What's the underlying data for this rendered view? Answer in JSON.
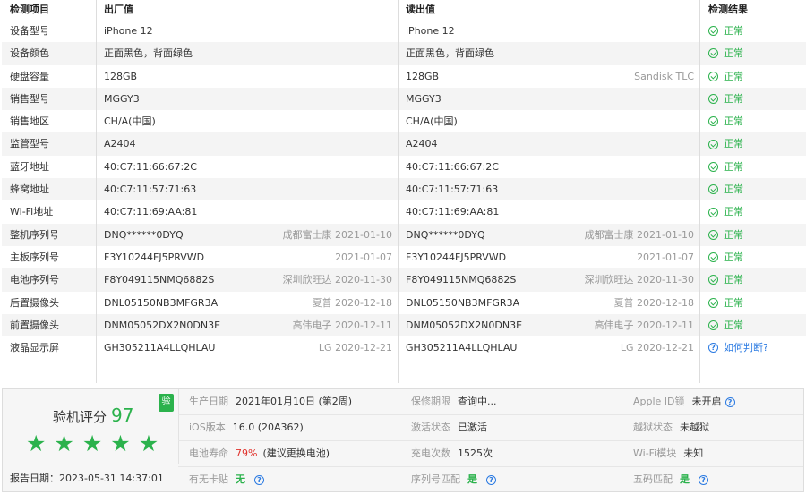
{
  "header": {
    "col1": "检测项目",
    "col2": "出厂值",
    "col3": "读出值",
    "col4": "检测结果"
  },
  "rows": [
    {
      "name": "设备型号",
      "factory": "iPhone 12",
      "factory_note": "",
      "read": "iPhone 12",
      "read_note": "",
      "result": "正常"
    },
    {
      "name": "设备颜色",
      "factory": "正面黑色，背面绿色",
      "factory_note": "",
      "read": "正面黑色，背面绿色",
      "read_note": "",
      "result": "正常"
    },
    {
      "name": "硬盘容量",
      "factory": "128GB",
      "factory_note": "",
      "read": "128GB",
      "read_note": "Sandisk TLC",
      "result": "正常"
    },
    {
      "name": "销售型号",
      "factory": "MGGY3",
      "factory_note": "",
      "read": "MGGY3",
      "read_note": "",
      "result": "正常"
    },
    {
      "name": "销售地区",
      "factory": "CH/A(中国)",
      "factory_note": "",
      "read": "CH/A(中国)",
      "read_note": "",
      "result": "正常"
    },
    {
      "name": "监管型号",
      "factory": "A2404",
      "factory_note": "",
      "read": "A2404",
      "read_note": "",
      "result": "正常"
    },
    {
      "name": "蓝牙地址",
      "factory": "40:C7:11:66:67:2C",
      "factory_note": "",
      "read": "40:C7:11:66:67:2C",
      "read_note": "",
      "result": "正常"
    },
    {
      "name": "蜂窝地址",
      "factory": "40:C7:11:57:71:63",
      "factory_note": "",
      "read": "40:C7:11:57:71:63",
      "read_note": "",
      "result": "正常"
    },
    {
      "name": "Wi-Fi地址",
      "factory": "40:C7:11:69:AA:81",
      "factory_note": "",
      "read": "40:C7:11:69:AA:81",
      "read_note": "",
      "result": "正常"
    },
    {
      "name": "整机序列号",
      "factory": "DNQ******0DYQ",
      "factory_note": "成都富士康 2021-01-10",
      "read": "DNQ******0DYQ",
      "read_note": "成都富士康 2021-01-10",
      "result": "正常"
    },
    {
      "name": "主板序列号",
      "factory": "F3Y10244FJ5PRVWD",
      "factory_note": "2021-01-07",
      "read": "F3Y10244FJ5PRVWD",
      "read_note": "2021-01-07",
      "result": "正常"
    },
    {
      "name": "电池序列号",
      "factory": "F8Y049115NMQ6882S",
      "factory_note": "深圳欣旺达 2020-11-30",
      "read": "F8Y049115NMQ6882S",
      "read_note": "深圳欣旺达 2020-11-30",
      "result": "正常"
    },
    {
      "name": "后置摄像头",
      "factory": "DNL05150NB3MFGR3A",
      "factory_note": "夏普 2020-12-18",
      "read": "DNL05150NB3MFGR3A",
      "read_note": "夏普 2020-12-18",
      "result": "正常"
    },
    {
      "name": "前置摄像头",
      "factory": "DNM05052DX2N0DN3E",
      "factory_note": "高伟电子 2020-12-11",
      "read": "DNM05052DX2N0DN3E",
      "read_note": "高伟电子 2020-12-11",
      "result": "正常"
    },
    {
      "name": "液晶显示屏",
      "factory": "GH305211A4LLQHLAU",
      "factory_note": "LG 2020-12-21",
      "read": "GH305211A4LLQHLAU",
      "read_note": "LG 2020-12-21",
      "result": "如何判断?",
      "result_type": "help"
    }
  ],
  "score": {
    "label": "验机评分",
    "value": "97",
    "badge": "验",
    "stars": 5,
    "date": "报告日期：2023-05-31 14:37:01"
  },
  "info": [
    [
      {
        "label": "生产日期",
        "value": "2021年01月10日 (第2周)"
      },
      {
        "label": "保修期限",
        "value": "查询中..."
      },
      {
        "label": "Apple ID锁",
        "value": "未开启",
        "help": true
      }
    ],
    [
      {
        "label": "iOS版本",
        "value": "16.0 (20A362)"
      },
      {
        "label": "激活状态",
        "value": "已激活"
      },
      {
        "label": "越狱状态",
        "value": "未越狱"
      }
    ],
    [
      {
        "label": "电池寿命",
        "value_red": "79%",
        "value": "(建议更换电池)"
      },
      {
        "label": "充电次数",
        "value": "1525次"
      },
      {
        "label": "Wi-Fi模块",
        "value": "未知"
      }
    ],
    [
      {
        "label": "有无卡贴",
        "value_green": "无",
        "help": true
      },
      {
        "label": "序列号匹配",
        "value_green": "是",
        "help": true
      },
      {
        "label": "五码匹配",
        "value_green": "是",
        "help": true
      }
    ]
  ]
}
